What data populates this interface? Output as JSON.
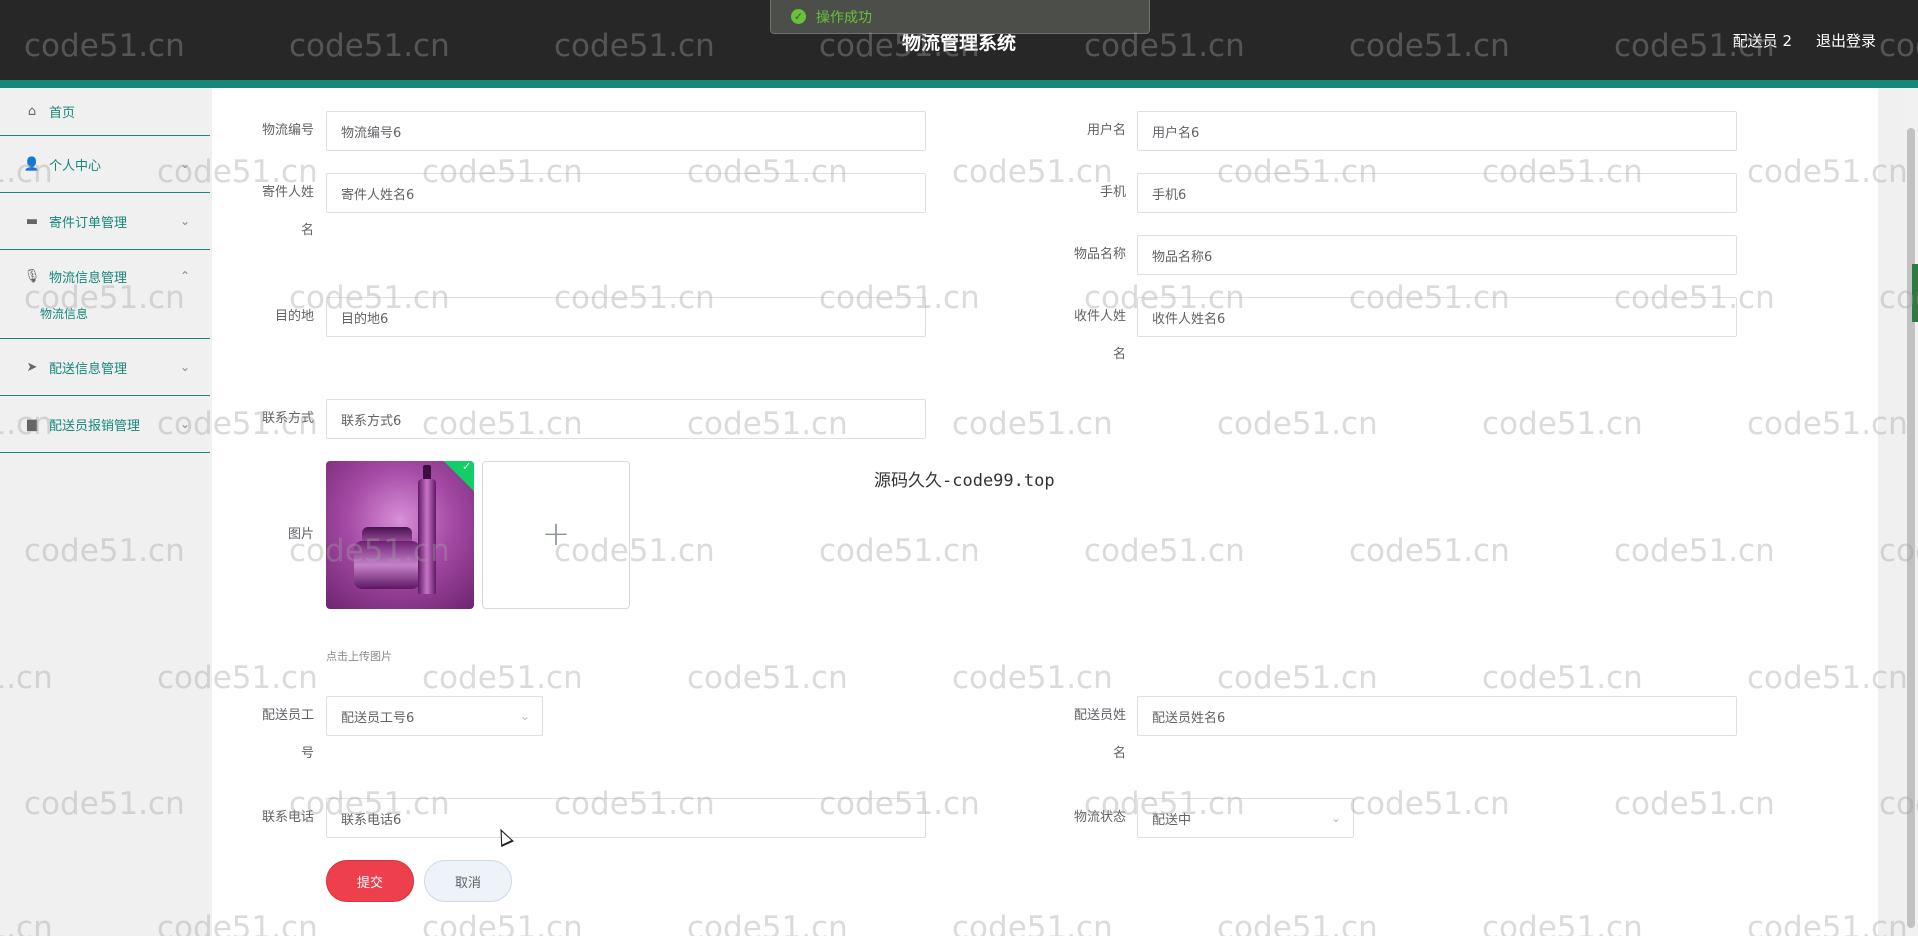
{
  "header": {
    "title": "物流管理系统",
    "user": "配送员 2",
    "logout": "退出登录"
  },
  "toast": {
    "text": "操作成功",
    "icon": "success-icon"
  },
  "sidebar": {
    "items": [
      {
        "label": "首页",
        "icon": "home-icon"
      },
      {
        "label": "个人中心",
        "icon": "user-icon"
      },
      {
        "label": "寄件订单管理",
        "icon": "chat-icon"
      },
      {
        "label": "物流信息管理",
        "icon": "microphone-icon",
        "expanded": true,
        "children": [
          "物流信息"
        ]
      },
      {
        "label": "配送信息管理",
        "icon": "send-icon"
      },
      {
        "label": "配送员报销管理",
        "icon": "monitor-icon"
      }
    ]
  },
  "form": {
    "logistics_no": {
      "label": "物流编号",
      "value": "物流编号6"
    },
    "username": {
      "label": "用户名",
      "value": "用户名6"
    },
    "sender_name": {
      "label": "寄件人姓名",
      "value": "寄件人姓名6"
    },
    "phone": {
      "label": "手机",
      "value": "手机6"
    },
    "item_name": {
      "label": "物品名称",
      "value": "物品名称6"
    },
    "destination": {
      "label": "目的地",
      "value": "目的地6"
    },
    "receiver_name": {
      "label": "收件人姓名",
      "value": "收件人姓名6"
    },
    "contact": {
      "label": "联系方式",
      "value": "联系方式6"
    },
    "image": {
      "label": "图片",
      "hint": "点击上传图片"
    },
    "courier_id": {
      "label": "配送员工号",
      "value": "配送员工号6"
    },
    "courier_name": {
      "label": "配送员姓名",
      "value": "配送员姓名6"
    },
    "contact_phone": {
      "label": "联系电话",
      "value": "联系电话6"
    },
    "status": {
      "label": "物流状态",
      "value": "配送中"
    }
  },
  "buttons": {
    "submit": "提交",
    "cancel": "取消"
  },
  "overlay_text": "源码久久-code99.top",
  "watermark": "code51.cn",
  "colors": {
    "accent": "#15887a",
    "submit": "#ee3f4d",
    "header": "#272727"
  }
}
